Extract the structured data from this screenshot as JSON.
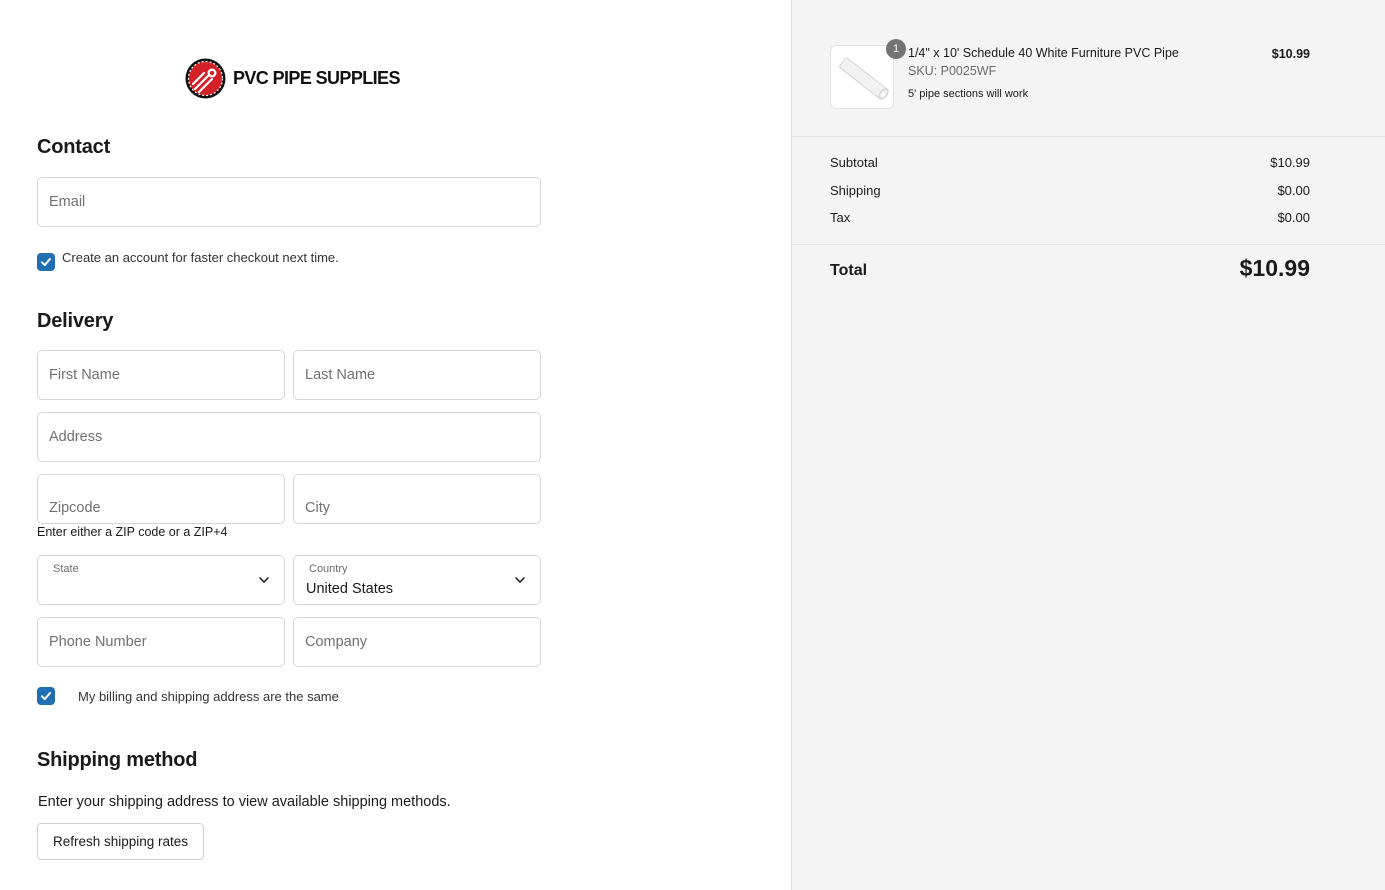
{
  "brand": {
    "name": "PVC PIPE SUPPLIES"
  },
  "contact": {
    "heading": "Contact",
    "email_placeholder": "Email",
    "create_account_label": "Create an account for faster checkout next time.",
    "create_account_checked": true
  },
  "delivery": {
    "heading": "Delivery",
    "first_name_placeholder": "First Name",
    "last_name_placeholder": "Last Name",
    "address_placeholder": "Address",
    "zip_placeholder": "Zipcode",
    "city_placeholder": "City",
    "zip_hint": "Enter either a ZIP code or a ZIP+4",
    "state_label": "State",
    "state_value": "",
    "country_label": "Country",
    "country_value": "United States",
    "phone_placeholder": "Phone Number",
    "company_placeholder": "Company",
    "billing_same_label": "My billing and shipping address are the same",
    "billing_same_checked": true
  },
  "shipping": {
    "heading": "Shipping method",
    "message": "Enter your shipping address to view available shipping methods.",
    "refresh_button": "Refresh shipping rates"
  },
  "cart": {
    "item": {
      "quantity": "1",
      "name": "1/4\" x 10' Schedule 40 White Furniture PVC Pipe",
      "sku": "SKU: P0025WF",
      "note": "5' pipe sections will work",
      "price": "$10.99"
    },
    "subtotal_label": "Subtotal",
    "subtotal_value": "$10.99",
    "shipping_label": "Shipping",
    "shipping_value": "$0.00",
    "tax_label": "Tax",
    "tax_value": "$0.00",
    "total_label": "Total",
    "total_value": "$10.99"
  },
  "colors": {
    "checkbox": "#1f6fb2",
    "logo_red": "#d42027",
    "sidebar_bg": "#f4f4f4"
  }
}
